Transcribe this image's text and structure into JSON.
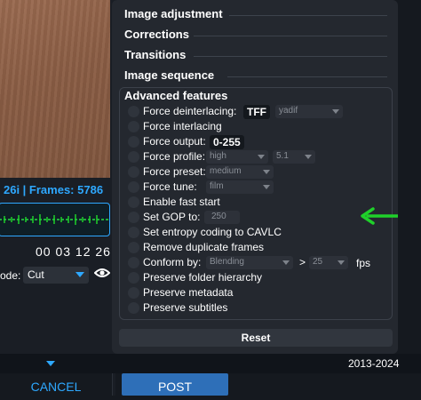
{
  "left": {
    "frames_text": "26i | Frames: 5786",
    "timecode": "00 03 12 26",
    "mode_label": "ode:",
    "mode_value": "Cut"
  },
  "sections": [
    {
      "label": "Image adjustment"
    },
    {
      "label": "Corrections"
    },
    {
      "label": "Transitions"
    },
    {
      "label": "Image sequence"
    }
  ],
  "advanced": {
    "title": "Advanced features",
    "options": {
      "deinterlacing": {
        "label": "Force deinterlacing:",
        "badge": "TFF",
        "select": "yadif"
      },
      "interlacing": {
        "label": "Force interlacing"
      },
      "output": {
        "label": "Force output:",
        "badge": "0-255"
      },
      "profile": {
        "label": "Force profile:",
        "select1": "high",
        "select2": "5.1"
      },
      "preset": {
        "label": "Force preset:",
        "select": "medium"
      },
      "tune": {
        "label": "Force tune:",
        "select": "film"
      },
      "fast_start": {
        "label": "Enable fast start"
      },
      "gop": {
        "label": "Set GOP to:",
        "value": "250"
      },
      "cavlc": {
        "label": "Set entropy coding to CAVLC"
      },
      "dup_frames": {
        "label": "Remove duplicate frames"
      },
      "conform": {
        "label": "Conform by:",
        "select": "Blending",
        "gt": ">",
        "fps_value": "25",
        "fps_label": "fps"
      },
      "folder": {
        "label": "Preserve folder hierarchy"
      },
      "metadata": {
        "label": "Preserve metadata"
      },
      "subtitles": {
        "label": "Preserve subtitles"
      }
    },
    "reset_label": "Reset"
  },
  "footer": {
    "copyright": "2013-2024",
    "cancel_label": "CANCEL",
    "post_label": "POST"
  },
  "colors": {
    "accent": "#2ea8ff",
    "arrow": "#1fd02a",
    "post_button": "#2e6fb8"
  }
}
